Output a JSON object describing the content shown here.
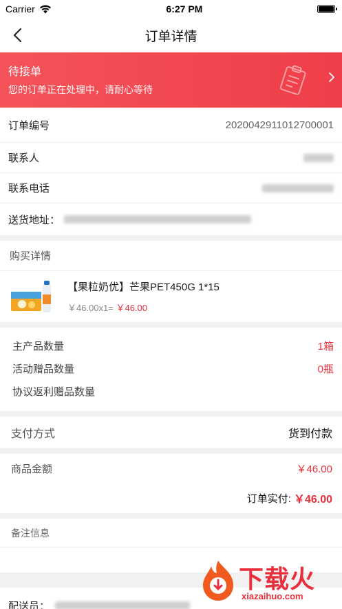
{
  "status_bar": {
    "carrier": "Carrier",
    "time": "6:27 PM"
  },
  "nav": {
    "title": "订单详情"
  },
  "banner": {
    "title": "待接单",
    "subtitle": "您的订单正在处理中，请耐心等待"
  },
  "order_info": {
    "order_no_label": "订单编号",
    "order_no_value": "2020042911012700001",
    "contact_label": "联系人",
    "phone_label": "联系电话",
    "address_label": "送货地址："
  },
  "purchase": {
    "header": "购买详情",
    "product_name": "【果粒奶优】芒果PET450G 1*15",
    "product_price_calc": "￥46.00x1=",
    "product_total": "￥46.00"
  },
  "quantities": [
    {
      "label": "主产品数量",
      "value": "1箱"
    },
    {
      "label": "活动赠品数量",
      "value": "0瓶"
    },
    {
      "label": "协议返利赠品数量",
      "value": ""
    }
  ],
  "payment": {
    "label": "支付方式",
    "value": "货到付款"
  },
  "amount": {
    "goods_label": "商品金额",
    "goods_value": "￥46.00",
    "actual_label": "订单实付:",
    "actual_value": "￥46.00"
  },
  "remark": {
    "header": "备注信息"
  },
  "courier": {
    "label": "配送员："
  },
  "watermark": {
    "brand": "下载火",
    "url": "xiazaihuo.com"
  },
  "colors": {
    "accent_red": "#e8303c",
    "banner_start": "#f4535a",
    "banner_end": "#ef3e49"
  }
}
